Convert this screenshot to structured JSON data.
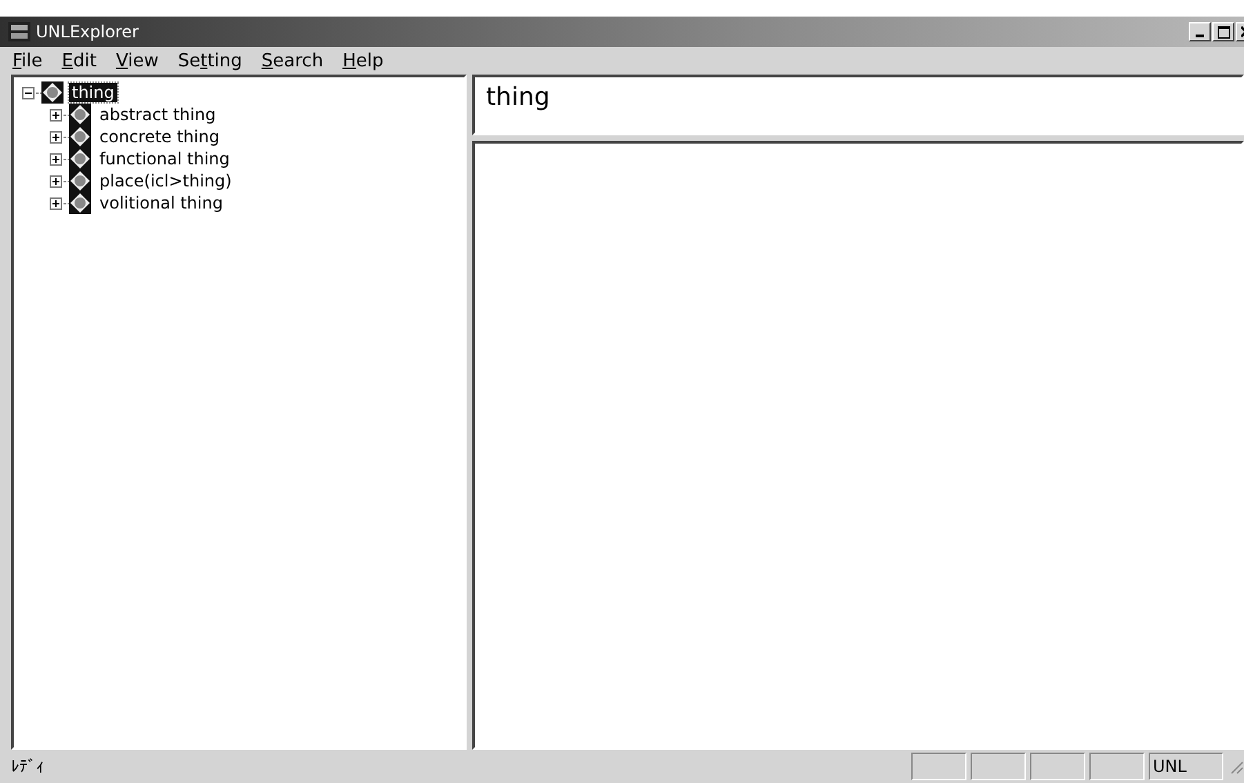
{
  "window": {
    "title": "UNLExplorer"
  },
  "menu": [
    {
      "key": "F",
      "rest": "ile"
    },
    {
      "key": "E",
      "rest": "dit"
    },
    {
      "key": "V",
      "rest": "iew"
    },
    {
      "lead": "Se",
      "key": "t",
      "rest": "ting"
    },
    {
      "key": "S",
      "rest": "earch"
    },
    {
      "key": "H",
      "rest": "elp"
    }
  ],
  "tree": [
    {
      "label": "thing",
      "expanded": true,
      "selected": true,
      "children": [
        {
          "label": "abstract thing",
          "expanded": false,
          "selected": false
        },
        {
          "label": "concrete thing",
          "expanded": false,
          "selected": false
        },
        {
          "label": "functional thing",
          "expanded": false,
          "selected": false
        },
        {
          "label": "place(icl>thing)",
          "expanded": false,
          "selected": false
        },
        {
          "label": "volitional thing",
          "expanded": false,
          "selected": false
        }
      ]
    }
  ],
  "detail": {
    "heading": "thing"
  },
  "status_bar": {
    "message": "ﾚﾃﾞｨ",
    "panes": [
      {
        "kind": "empty"
      },
      {
        "kind": "empty"
      },
      {
        "kind": "empty"
      },
      {
        "kind": "empty"
      },
      {
        "kind": "text",
        "text": "UNL"
      }
    ]
  }
}
